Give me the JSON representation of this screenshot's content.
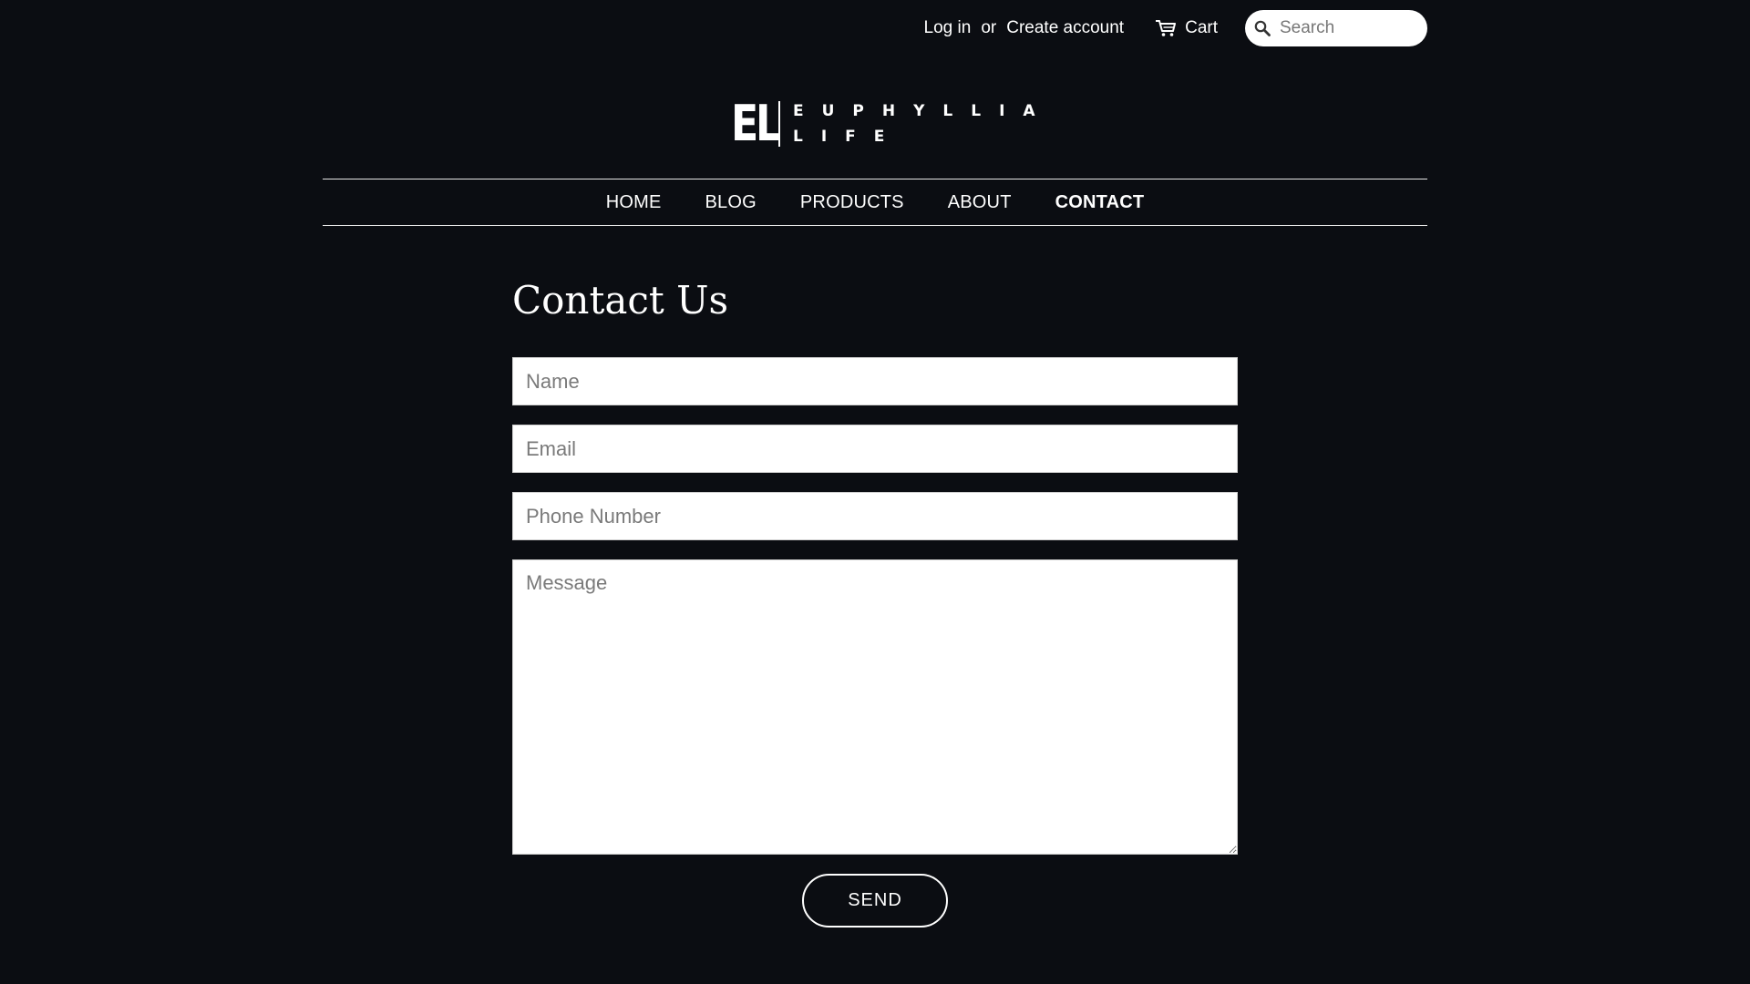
{
  "header": {
    "login_label": "Log in",
    "or_label": "or",
    "create_account_label": "Create account",
    "cart_label": "Cart",
    "search_placeholder": "Search"
  },
  "logo": {
    "mark": "EL",
    "line1": "EUPHYLLIA",
    "line2": "LIFE"
  },
  "nav": {
    "items": [
      {
        "label": "HOME"
      },
      {
        "label": "BLOG"
      },
      {
        "label": "PRODUCTS"
      },
      {
        "label": "ABOUT"
      },
      {
        "label": "CONTACT",
        "active": true
      }
    ]
  },
  "contact": {
    "title": "Contact Us",
    "name_placeholder": "Name",
    "email_placeholder": "Email",
    "phone_placeholder": "Phone Number",
    "message_placeholder": "Message",
    "send_label": "SEND"
  },
  "colors": {
    "background": "#0b0d12",
    "text": "#ffffff",
    "field_background": "#ffffff"
  }
}
